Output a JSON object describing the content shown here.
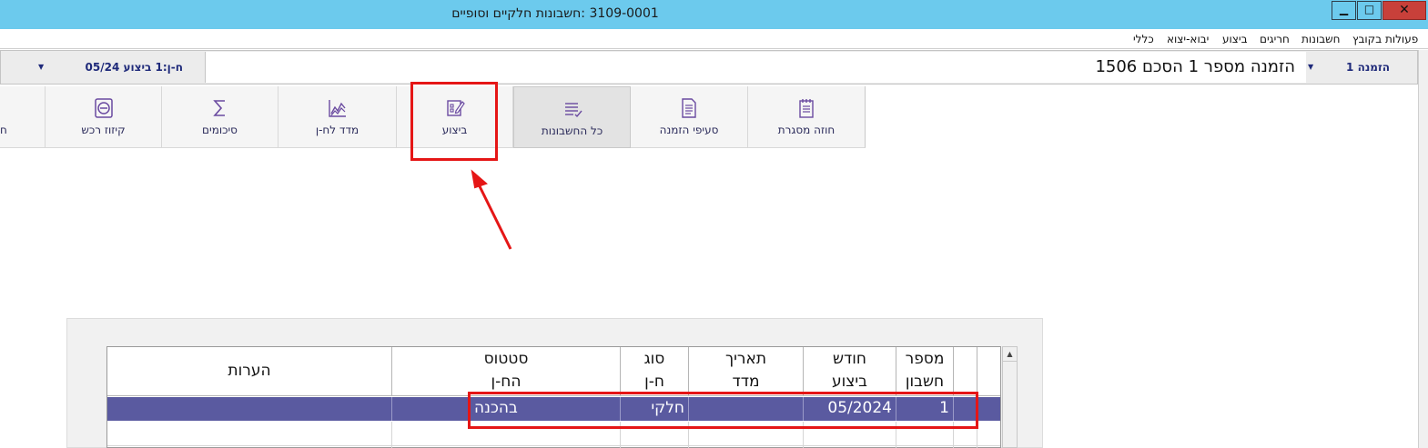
{
  "window": {
    "title": "3109-0001 :חשבונות חלקיים וסופיים",
    "min_glyph": "▁",
    "max_glyph": "□",
    "close_glyph": "✕"
  },
  "menu": [
    "פעולות בקובץ",
    "חשבונות",
    "חריגים",
    "ביצוע",
    "יבוא-יצוא",
    "כללי"
  ],
  "selector": {
    "left_value": "ח-ן:1 ביצוע 05/24",
    "main_value": "הזמנה מספר 1 הסכם 1506",
    "right_value": "הזמנה 1"
  },
  "tabs": {
    "frame_contract": "חוזה מסגרת",
    "order_sections": "סעיפי הזמנה",
    "all_accounts": "כל החשבונות",
    "execution": "ביצוע",
    "index": "מדד לח-ן",
    "summaries": "סיכומים",
    "equipment_allocation": "קיזוז רכש",
    "edge_fragment": "ח"
  },
  "grid": {
    "headers": {
      "account_no": [
        "מספר",
        "חשבון"
      ],
      "exec_month": [
        "חודש",
        "ביצוע"
      ],
      "index_date": [
        "תאריך",
        "מדד"
      ],
      "type": [
        "סוג",
        "ח-ן"
      ],
      "status": [
        "סטטוס",
        "הח-ן"
      ],
      "notes": [
        "הערות",
        ""
      ]
    },
    "rows": [
      {
        "account_no": "1",
        "exec_month": "05/2024",
        "index_date": "",
        "type": "חלקי",
        "status": "בהכנה",
        "notes": ""
      }
    ]
  },
  "colors": {
    "titlebar": "#6ccaed",
    "selected_row": "#5a5aa0",
    "highlight": "#e51616",
    "nav_text": "#1f2a7a"
  }
}
